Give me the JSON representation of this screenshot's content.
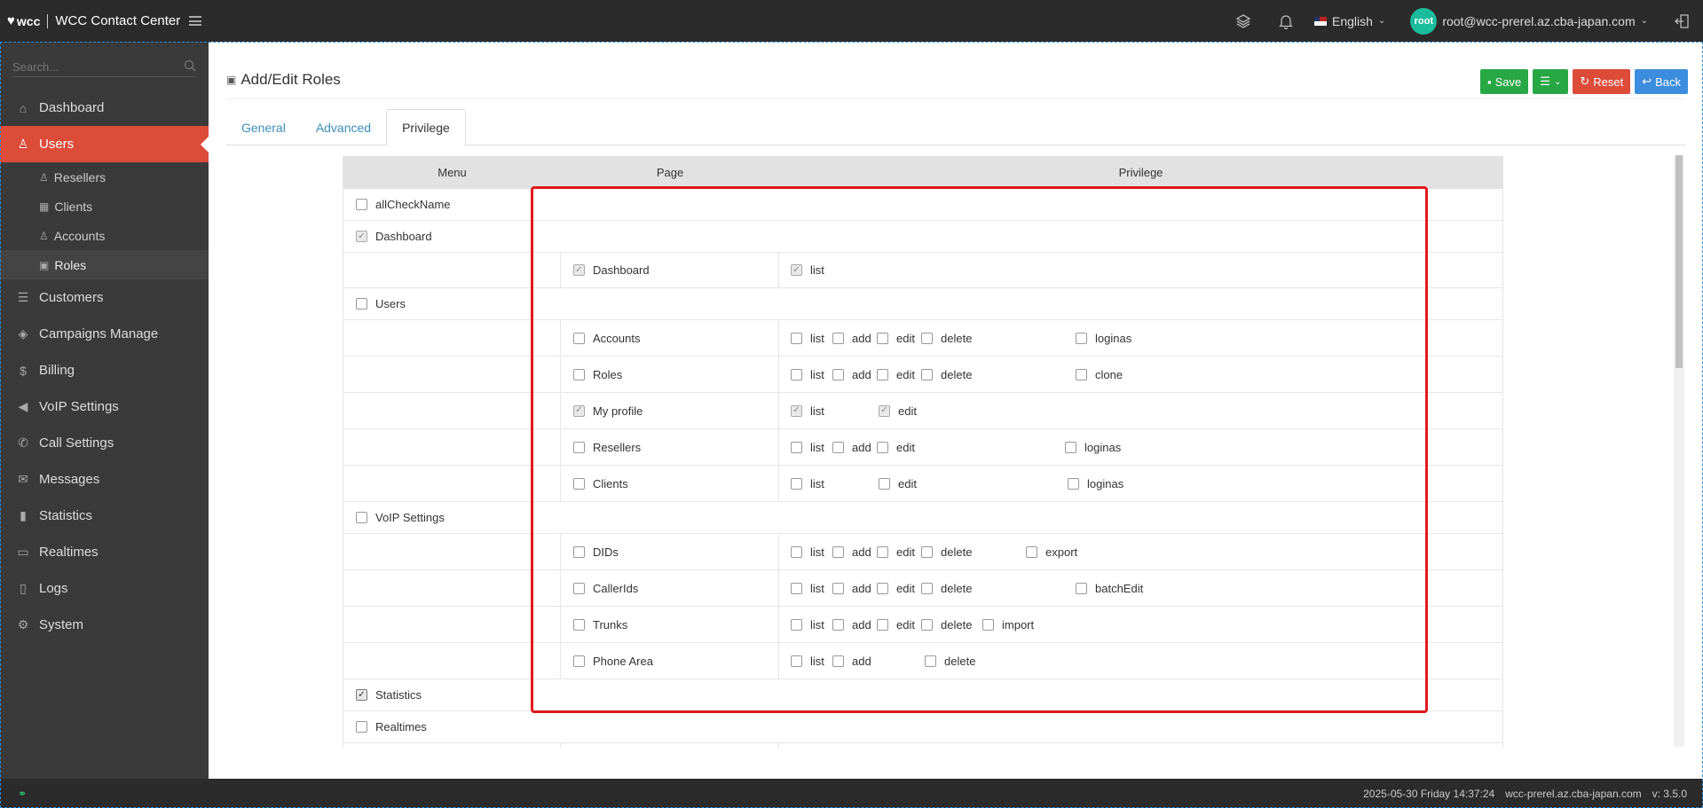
{
  "app": {
    "logo": "wcc",
    "title": "WCC Contact Center"
  },
  "topbar": {
    "language": "English",
    "avatar_text": "root",
    "user_email": "root@wcc-prerel.az.cba-japan.com"
  },
  "sidebar": {
    "search_placeholder": "Search...",
    "items": [
      {
        "label": "Dashboard",
        "icon": "home-icon"
      },
      {
        "label": "Users",
        "icon": "user-icon"
      },
      {
        "label": "Customers",
        "icon": "database-icon"
      },
      {
        "label": "Campaigns Manage",
        "icon": "layers-icon"
      },
      {
        "label": "Billing",
        "icon": "dollar-icon"
      },
      {
        "label": "VoIP Settings",
        "icon": "volume-icon"
      },
      {
        "label": "Call Settings",
        "icon": "phone-icon"
      },
      {
        "label": "Messages",
        "icon": "envelope-icon"
      },
      {
        "label": "Statistics",
        "icon": "bar-chart-icon"
      },
      {
        "label": "Realtimes",
        "icon": "monitor-icon"
      },
      {
        "label": "Logs",
        "icon": "book-icon"
      },
      {
        "label": "System",
        "icon": "gear-icon"
      }
    ],
    "users_sub": [
      {
        "label": "Resellers"
      },
      {
        "label": "Clients"
      },
      {
        "label": "Accounts"
      },
      {
        "label": "Roles"
      }
    ]
  },
  "page": {
    "title": "Add/Edit Roles",
    "buttons": {
      "save": "Save",
      "reset": "Reset",
      "back": "Back"
    },
    "tabs": [
      "General",
      "Advanced",
      "Privilege"
    ]
  },
  "table": {
    "headers": {
      "menu": "Menu",
      "page": "Page",
      "privilege": "Privilege"
    },
    "all_check": "allCheckName",
    "menus": {
      "dashboard": "Dashboard",
      "users": "Users",
      "voip": "VoIP Settings",
      "statistics": "Statistics",
      "realtimes": "Realtimes"
    },
    "pages": {
      "dashboard": "Dashboard",
      "accounts": "Accounts",
      "roles": "Roles",
      "myprofile": "My profile",
      "resellers": "Resellers",
      "clients": "Clients",
      "dids": "DIDs",
      "callerids": "CallerIds",
      "trunks": "Trunks",
      "phonearea": "Phone Area"
    },
    "privs": {
      "list": "list",
      "add": "add",
      "edit": "edit",
      "delete": "delete",
      "loginas": "loginas",
      "clone": "clone",
      "export": "export",
      "batchEdit": "batchEdit",
      "import": "import"
    }
  },
  "footer": {
    "datetime": "2025-05-30 Friday 14:37:24",
    "host": "wcc-prerel.az.cba-japan.com",
    "version": "v: 3.5.0"
  }
}
